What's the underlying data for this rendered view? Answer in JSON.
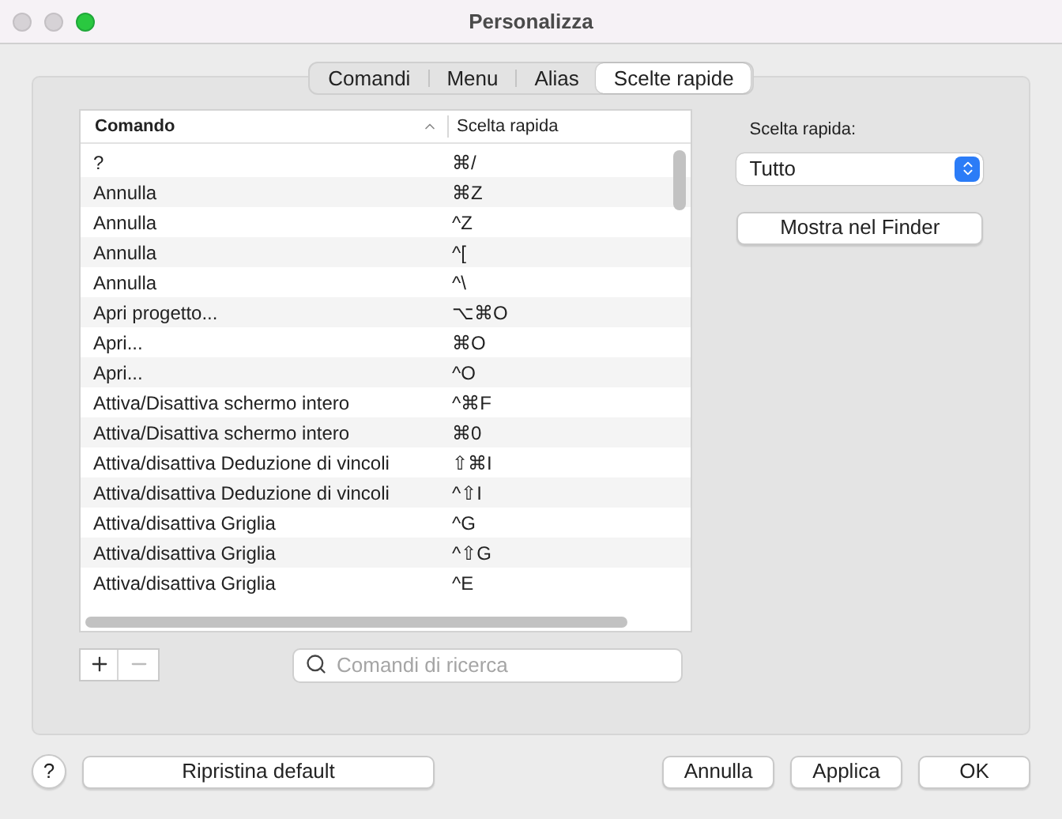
{
  "window": {
    "title": "Personalizza"
  },
  "tabs": [
    {
      "label": "Comandi",
      "selected": false
    },
    {
      "label": "Menu",
      "selected": false
    },
    {
      "label": "Alias",
      "selected": false
    },
    {
      "label": "Scelte rapide",
      "selected": true
    }
  ],
  "table": {
    "columns": [
      "Comando",
      "Scelta rapida"
    ],
    "rows": [
      [
        "?",
        "⌘/"
      ],
      [
        "Annulla",
        "⌘Z"
      ],
      [
        "Annulla",
        "^Z"
      ],
      [
        "Annulla",
        "^["
      ],
      [
        "Annulla",
        "^\\"
      ],
      [
        "Apri progetto...",
        "⌥⌘O"
      ],
      [
        "Apri...",
        "⌘O"
      ],
      [
        "Apri...",
        "^O"
      ],
      [
        "Attiva/Disattiva schermo intero",
        "^⌘F"
      ],
      [
        "Attiva/Disattiva schermo intero",
        "⌘0"
      ],
      [
        "Attiva/disattiva Deduzione di vincoli",
        "⇧⌘I"
      ],
      [
        "Attiva/disattiva Deduzione di vincoli",
        "^⇧I"
      ],
      [
        "Attiva/disattiva Griglia",
        "^G"
      ],
      [
        "Attiva/disattiva Griglia",
        "^⇧G"
      ],
      [
        "Attiva/disattiva Griglia",
        "^E"
      ]
    ]
  },
  "search": {
    "placeholder": "Comandi di ricerca"
  },
  "filter": {
    "label": "Scelta rapida:",
    "value": "Tutto"
  },
  "reveal_button": "Mostra nel Finder",
  "help_button": "?",
  "reset_button": "Ripristina default",
  "buttons": [
    "Annulla",
    "Applica",
    "OK"
  ]
}
